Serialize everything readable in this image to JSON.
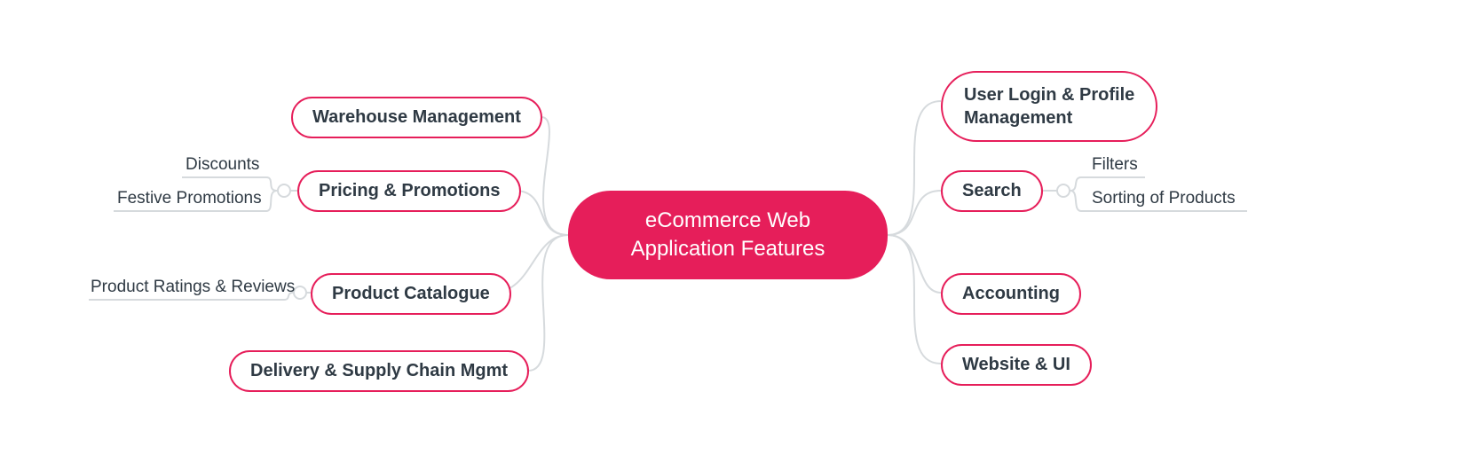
{
  "center": {
    "title": "eCommerce Web\nApplication Features"
  },
  "left": {
    "warehouse": {
      "label": "Warehouse Management"
    },
    "pricing": {
      "label": "Pricing & Promotions",
      "children": {
        "discounts": "Discounts",
        "festive": "Festive Promotions"
      }
    },
    "catalogue": {
      "label": "Product Catalogue",
      "children": {
        "reviews": "Product Ratings & Reviews"
      }
    },
    "delivery": {
      "label": "Delivery & Supply Chain Mgmt"
    }
  },
  "right": {
    "user": {
      "label": "User Login & Profile\nManagement"
    },
    "search": {
      "label": "Search",
      "children": {
        "filters": "Filters",
        "sorting": "Sorting of Products"
      }
    },
    "accounting": {
      "label": "Accounting"
    },
    "website": {
      "label": "Website & UI"
    }
  },
  "colors": {
    "accent": "#e61e5a",
    "text": "#2f3a44",
    "connector": "#d6dadd"
  }
}
